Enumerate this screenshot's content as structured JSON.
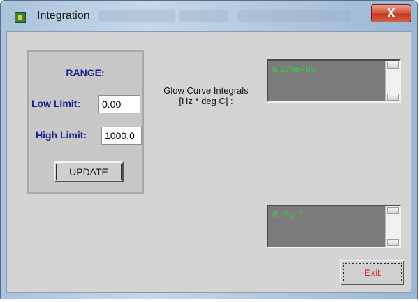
{
  "window": {
    "title": "Integration",
    "close_symbol": "X",
    "icon": "app-icon"
  },
  "range": {
    "title": "RANGE:",
    "low_label": "Low Limit:",
    "low_value": "0.00",
    "high_label": "High Limit:",
    "high_value": "1000.0",
    "update_label": "UPDATE"
  },
  "integrals": {
    "label_line1": "Glow Curve Integrals",
    "label_line2": "[Hz * deg C] :",
    "value": "6.276e+05"
  },
  "dose_list": {
    "value": "8  Gy  1"
  },
  "exit_label": "Exit",
  "colors": {
    "label_blue": "#1a1f8a",
    "list_text_green": "#34d34a",
    "exit_text_red": "#e11a1a",
    "close_button_red": "#c23b22"
  }
}
